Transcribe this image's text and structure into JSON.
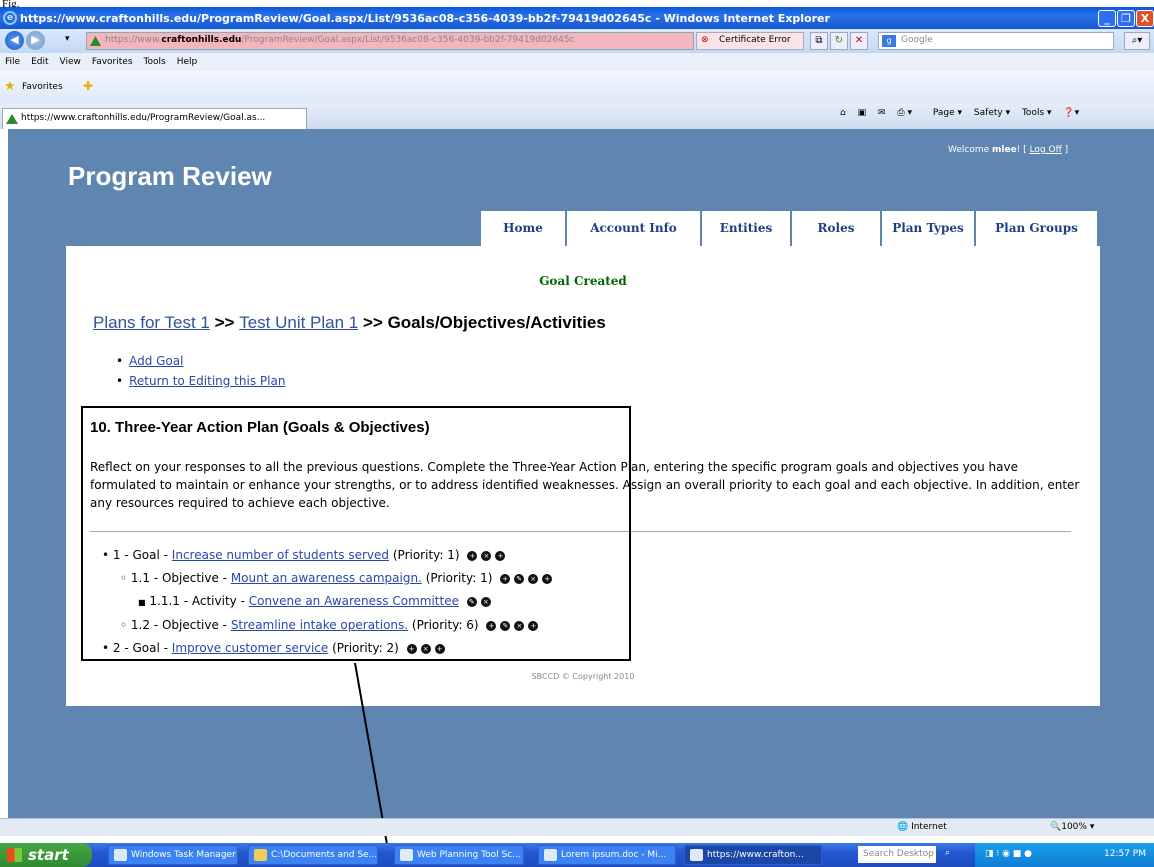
{
  "fig_label": "Fig.",
  "window": {
    "title": "https://www.craftonhills.edu/ProgramReview/Goal.aspx/List/9536ac08-c356-4039-bb2f-79419d02645c - Windows Internet Explorer",
    "minimize": "_",
    "maximize": "❐",
    "close": "X"
  },
  "address": {
    "url_prefix": "https://www.",
    "url_domain": "craftonhills.edu",
    "url_rest": "/ProgramReview/Goal.aspx/List/9536ac08-c356-4039-bb2f-79419d02645c",
    "cert_error": "Certificate Error",
    "search_placeholder": "Google",
    "back_icon": "back-icon",
    "forward_icon": "forward-icon"
  },
  "menu": [
    "File",
    "Edit",
    "View",
    "Favorites",
    "Tools",
    "Help"
  ],
  "favorites": {
    "label": "Favorites"
  },
  "tab": {
    "label": "https://www.craftonhills.edu/ProgramReview/Goal.as..."
  },
  "commands": [
    "▾",
    "Page ▾",
    "Safety ▾",
    "Tools ▾",
    "❓▾"
  ],
  "site": {
    "welcome_prefix": "Welcome ",
    "user": "mlee",
    "welcome_suffix": "! [",
    "logoff": "Log Off",
    "close_bracket": "]",
    "app_title": "Program Review",
    "nav": [
      "Home",
      "Account Info",
      "Entities",
      "Roles",
      "Plan Types",
      "Plan Groups"
    ],
    "status_message": "Goal Created",
    "crumb1": "Plans for Test 1",
    "sep": ">>",
    "crumb2": "Test Unit Plan 1",
    "crumb3": "Goals/Objectives/Activities",
    "action_add": "Add Goal",
    "action_return": "Return to Editing this Plan",
    "section_heading": "10. Three-Year Action Plan (Goals & Objectives)",
    "section_desc": "Reflect on your responses to all the previous questions. Complete the Three-Year Action Plan, entering the specific program goals and objectives you have formulated to maintain or enhance your strengths, or to address identified weaknesses. Assign an overall priority to each goal and each objective. In addition, enter any resources required to achieve each objective.",
    "copyright": "SBCCD © Copyright 2010"
  },
  "tree": [
    {
      "bullet": "•",
      "prefix": "1 - Goal - ",
      "link": "Increase number of students served",
      "suffix": " (Priority: 1)",
      "icons": [
        "add-icon",
        "delete-icon",
        "add-icon"
      ]
    },
    {
      "bullet": "◦",
      "prefix": "1.1 - Objective - ",
      "link": "Mount an awareness campaign.",
      "suffix": " (Priority: 1)",
      "icons": [
        "add-icon",
        "edit-icon",
        "delete-icon",
        "add-icon"
      ]
    },
    {
      "bullet": "■",
      "prefix": "1.1.1 - Activity - ",
      "link": "Convene an Awareness Committee",
      "suffix": "",
      "icons": [
        "edit-icon",
        "delete-icon"
      ]
    },
    {
      "bullet": "◦",
      "prefix": "1.2 - Objective - ",
      "link": "Streamline intake operations.",
      "suffix": " (Priority: 6)",
      "icons": [
        "add-icon",
        "edit-icon",
        "delete-icon",
        "add-icon"
      ]
    },
    {
      "bullet": "•",
      "prefix": "2 - Goal - ",
      "link": "Improve customer service",
      "suffix": " (Priority: 2)",
      "icons": [
        "add-icon",
        "delete-icon",
        "add-icon"
      ]
    }
  ],
  "status": {
    "zone": "Internet",
    "zoom": "100%"
  },
  "taskbar": {
    "start": "start",
    "tasks": [
      "Windows Task Manager",
      "C:\\Documents and Se...",
      "Web Planning Tool Sc...",
      "Lorem ipsum.doc - Mi...",
      "https://www.crafton..."
    ],
    "search": "Search Desktop",
    "clock": "12:57 PM"
  }
}
